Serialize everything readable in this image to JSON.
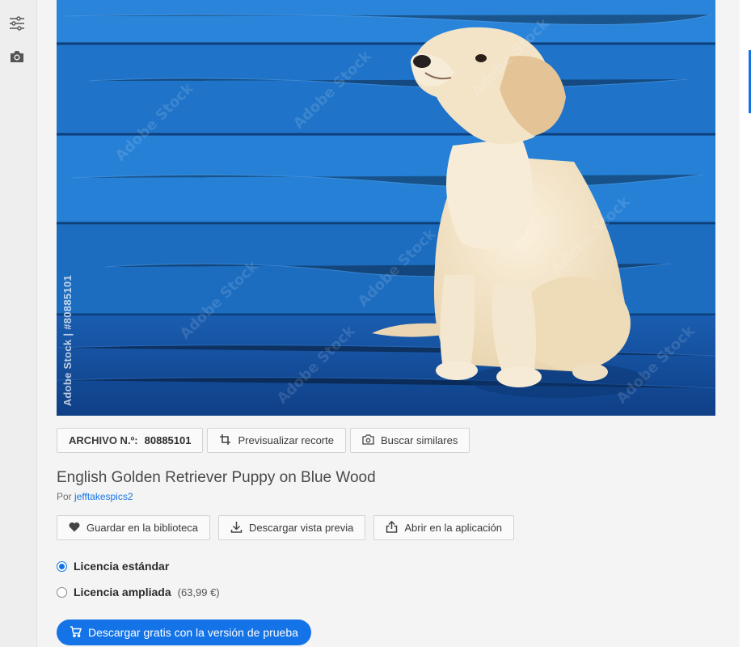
{
  "rail": {
    "icons": [
      "filters-icon",
      "camera-icon"
    ]
  },
  "photo": {
    "watermark_vertical": "Adobe Stock | #80885101",
    "watermark_text": "Adobe Stock",
    "colors": {
      "wall": "#1f6fc4",
      "floor": "#1452a3",
      "puppy": "#f1e2c6"
    }
  },
  "meta": {
    "file_label": "ARCHIVO N.º:",
    "file_number": "80885101",
    "preview_crop_label": "Previsualizar recorte",
    "find_similar_label": "Buscar similares"
  },
  "asset": {
    "title": "English Golden Retriever Puppy on Blue Wood",
    "by_prefix": "Por",
    "author": "jefftakespics2"
  },
  "actions": {
    "save_library": "Guardar en la biblioteca",
    "download_preview": "Descargar vista previa",
    "open_in_app": "Abrir en la aplicación"
  },
  "licenses": [
    {
      "name": "Licencia estándar",
      "price": "",
      "selected": true
    },
    {
      "name": "Licencia ampliada",
      "price": "(63,99 €)",
      "selected": false
    }
  ],
  "cta": {
    "label": "Descargar gratis con la versión de prueba",
    "color": "#1473e6"
  }
}
